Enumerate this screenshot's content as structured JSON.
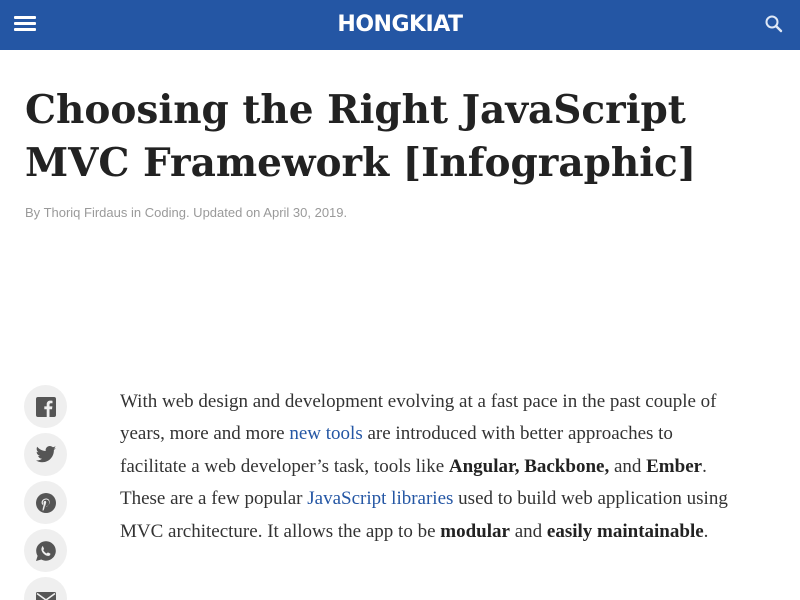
{
  "header": {
    "logo": "HONGKIAT",
    "icons": {
      "menu": "hamburger-menu-icon",
      "search": "search-icon"
    },
    "background_color": "#2456a4"
  },
  "article": {
    "title": "Choosing the Right JavaScript MVC Framework [Infographic]",
    "byline": {
      "by": "By",
      "author": "Thoriq Firdaus",
      "in": "in",
      "category": "Coding",
      "updated": ". Updated on April 30, 2019."
    },
    "body": {
      "t1": "With web design and development evolving at a fast pace in the past couple of years, more and more ",
      "link1": "new tools",
      "t2": " are introduced with better approaches to facilitate a web developer’s task, tools like ",
      "b1": "Angular, Backbone,",
      "t3": " and ",
      "b2": "Ember",
      "t4": ". These are a few popular ",
      "link2": "JavaScript libraries",
      "t5": " used to build web application using MVC architecture. It allows the app to be ",
      "b3": "modular",
      "t6": " and ",
      "b4": "easily maintainable",
      "t7": "."
    }
  },
  "share_buttons": [
    {
      "icon": "facebook-icon"
    },
    {
      "icon": "twitter-icon"
    },
    {
      "icon": "pinterest-icon"
    },
    {
      "icon": "whatsapp-icon"
    },
    {
      "icon": "email-icon"
    }
  ],
  "colors": {
    "link": "#2456a4",
    "share_icon": "#555555",
    "share_bg": "#efefef",
    "byline": "#9a9a9a"
  }
}
